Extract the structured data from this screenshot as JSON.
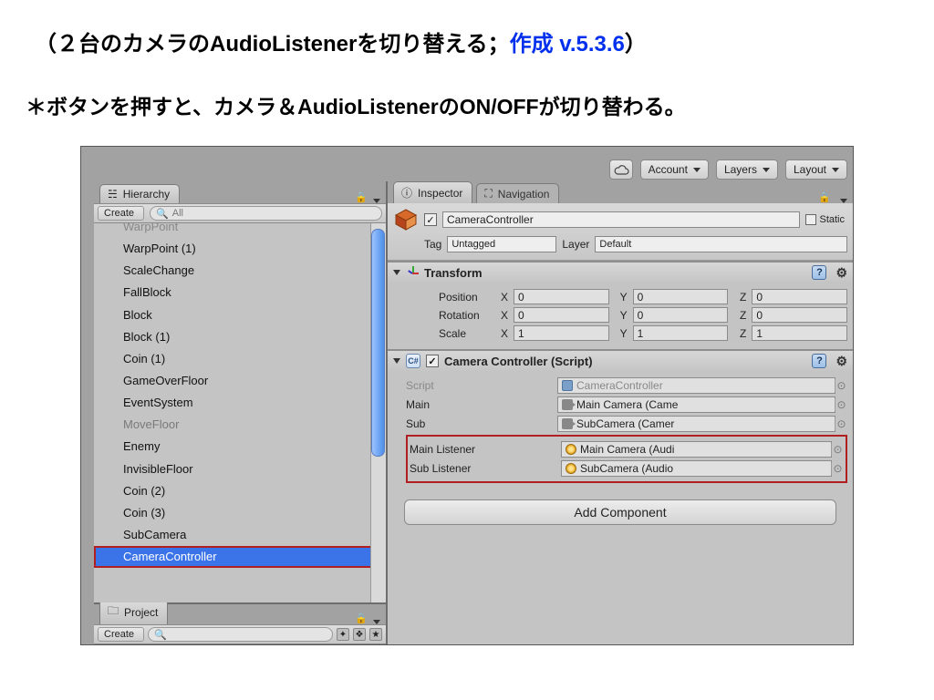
{
  "caption": {
    "line1_prefix": "（２台のカメラのAudioListenerを切り替える；",
    "line1_link": "作成 v.5.3.6",
    "line1_suffix": "）",
    "line2": "＊ボタンを押すと、カメラ＆AudioListenerのON/OFFが切り替わる。"
  },
  "toolbar": {
    "account": "Account",
    "layers": "Layers",
    "layout": "Layout"
  },
  "hierarchy": {
    "tab": "Hierarchy",
    "create": "Create",
    "searchPlaceholder": "All",
    "items": [
      {
        "label": "WarpPoint",
        "dim": false,
        "cut": true
      },
      {
        "label": "WarpPoint (1)",
        "dim": false
      },
      {
        "label": "ScaleChange",
        "dim": false
      },
      {
        "label": "FallBlock",
        "dim": false
      },
      {
        "label": "Block",
        "dim": false
      },
      {
        "label": "Block (1)",
        "dim": false
      },
      {
        "label": "Coin (1)",
        "dim": false
      },
      {
        "label": "GameOverFloor",
        "dim": false
      },
      {
        "label": "EventSystem",
        "dim": false
      },
      {
        "label": "MoveFloor",
        "dim": true
      },
      {
        "label": "Enemy",
        "dim": false
      },
      {
        "label": "InvisibleFloor",
        "dim": false
      },
      {
        "label": "Coin (2)",
        "dim": false
      },
      {
        "label": "Coin (3)",
        "dim": false
      },
      {
        "label": "SubCamera",
        "dim": false
      },
      {
        "label": "CameraController",
        "dim": false,
        "selected": true
      }
    ],
    "project": "Project",
    "projectCreate": "Create"
  },
  "inspector": {
    "tabs": {
      "inspector": "Inspector",
      "navigation": "Navigation"
    },
    "objectName": "CameraController",
    "static": "Static",
    "tagLabel": "Tag",
    "tagValue": "Untagged",
    "layerLabel": "Layer",
    "layerValue": "Default",
    "transform": {
      "title": "Transform",
      "position": "Position",
      "rotation": "Rotation",
      "scale": "Scale",
      "px": "0",
      "py": "0",
      "pz": "0",
      "rx": "0",
      "ry": "0",
      "rz": "0",
      "sx": "1",
      "sy": "1",
      "sz": "1"
    },
    "script": {
      "title": "Camera Controller (Script)",
      "scriptLabel": "Script",
      "scriptValue": "CameraController",
      "mainLabel": "Main",
      "mainValue": "Main Camera (Came",
      "subLabel": "Sub",
      "subValue": "SubCamera (Camer",
      "mainListenerLabel": "Main Listener",
      "mainListenerValue": "Main Camera (Audi",
      "subListenerLabel": "Sub Listener",
      "subListenerValue": "SubCamera (Audio"
    },
    "addComponent": "Add Component"
  },
  "axis": {
    "x": "X",
    "y": "Y",
    "z": "Z"
  }
}
